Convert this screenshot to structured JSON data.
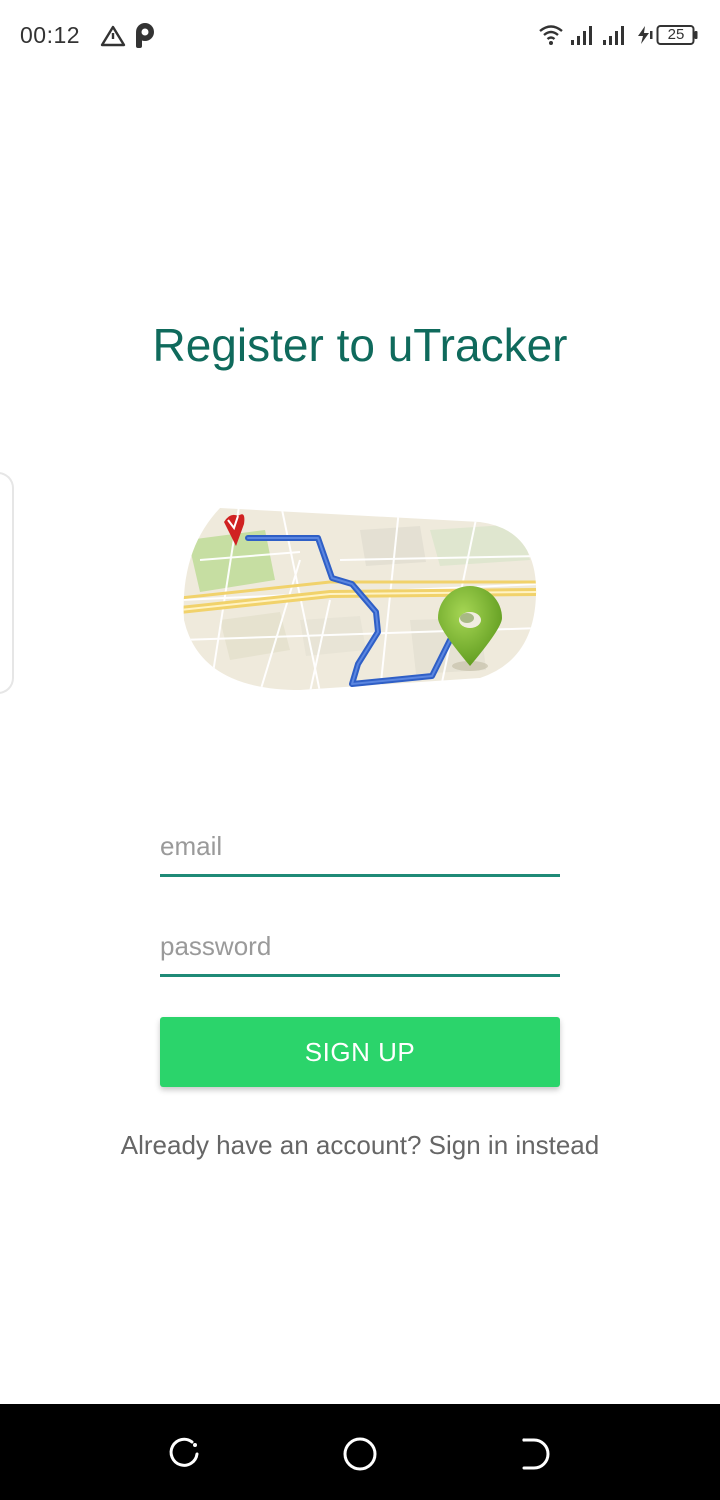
{
  "status_bar": {
    "time": "00:12",
    "battery_level": "25",
    "icons": [
      "alert-triangle-icon",
      "parking-app-icon",
      "wifi-icon",
      "signal-1-icon",
      "signal-2-icon",
      "charging-icon",
      "battery-icon"
    ]
  },
  "register": {
    "title": "Register to uTracker",
    "illustration": "map-route-icon",
    "email": {
      "value": "",
      "placeholder": "email"
    },
    "password": {
      "value": "",
      "placeholder": "password"
    },
    "signup_label": "SIGN UP",
    "signin_link": "Already have an account? Sign in instead"
  },
  "nav_bar": {
    "buttons": [
      "recent-apps-icon",
      "home-icon",
      "back-icon"
    ]
  },
  "colors": {
    "title": "#0f6a5c",
    "field_underline": "#1f8a77",
    "button": "#2bd46b",
    "nav_bar": "#000000"
  }
}
